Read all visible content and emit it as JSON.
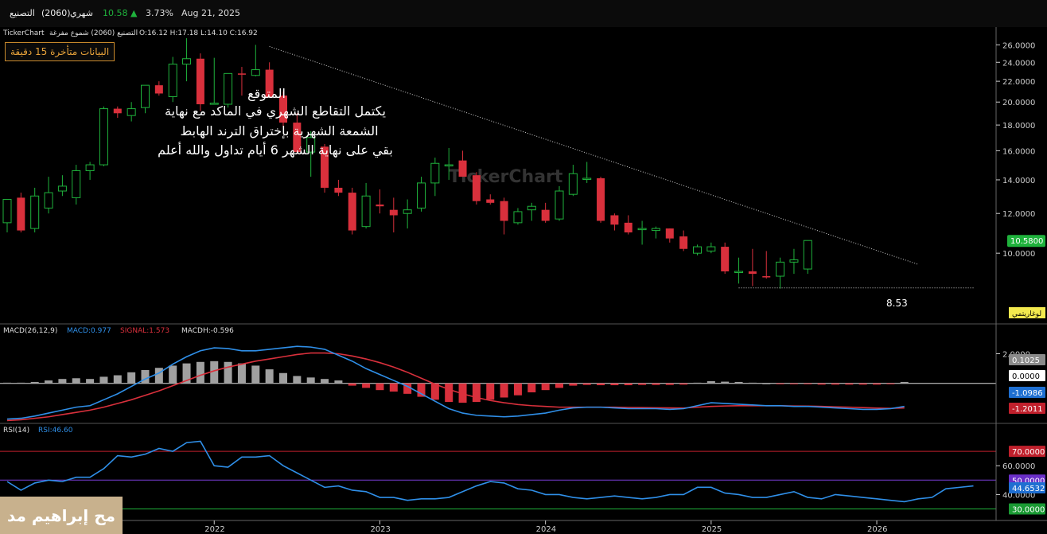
{
  "header": {
    "date": "Aug 21, 2025",
    "change_pct": "3.73%",
    "price": "10.58",
    "period": "شهري",
    "symbol": "(2060)",
    "name": "التصنيع"
  },
  "chart_header": {
    "brand": "TickerChart",
    "title": "التصنيع (2060) شموع مفرغة",
    "ohlc": "O:16.12  H:17.18  L:14.10  C:16.92"
  },
  "delay_notice": "البيانات متأخرة 15 دقيقة",
  "annotation": {
    "line1": "المتوقع",
    "line2": "يكتمل التقاطع الشهري في الماكد مع نهاية",
    "line3": "الشمعة الشهرية بإختراق الترند الهابط",
    "line4": "بقي على نهاية الشهر  6 أيام تداول والله أعلم"
  },
  "low_label": "8.53",
  "log_label": "لوغاريتمي",
  "watermark": "TickerChart",
  "author": "مح إبراهيم مد",
  "colors": {
    "up": "#1fb23c",
    "down": "#d9303c",
    "macd": "#2f8fe8",
    "signal": "#d9303c",
    "rsi": "#2f8fe8",
    "hist_pos": "#a0a0a0",
    "hist_neg": "#d9303c",
    "axis": "#cccccc"
  },
  "chart_data": [
    {
      "type": "candlestick",
      "title": "التصنيع (2060)",
      "scale": "log",
      "ylim": [
        7.5,
        27
      ],
      "yticks": [
        "26.0000",
        "24.0000",
        "22.0000",
        "20.0000",
        "18.0000",
        "16.0000",
        "14.0000",
        "12.0000",
        "10.0000"
      ],
      "xlabels": [
        {
          "label": "2022",
          "at": 15
        },
        {
          "label": "2023",
          "at": 27
        },
        {
          "label": "2024",
          "at": 39
        },
        {
          "label": "2025",
          "at": 51
        },
        {
          "label": "2026",
          "at": 63
        }
      ],
      "last_price": "10.5800",
      "candles": [
        {
          "o": 11.5,
          "h": 12.2,
          "l": 11.0,
          "c": 12.8
        },
        {
          "o": 12.9,
          "h": 13.2,
          "l": 11.0,
          "c": 11.1
        },
        {
          "o": 11.2,
          "h": 13.5,
          "l": 11.0,
          "c": 13.0
        },
        {
          "o": 12.3,
          "h": 14.2,
          "l": 12.0,
          "c": 13.2
        },
        {
          "o": 13.3,
          "h": 14.3,
          "l": 13.0,
          "c": 13.6
        },
        {
          "o": 12.9,
          "h": 15.0,
          "l": 12.5,
          "c": 14.6
        },
        {
          "o": 14.6,
          "h": 15.2,
          "l": 14.0,
          "c": 15.0
        },
        {
          "o": 15.0,
          "h": 19.6,
          "l": 14.9,
          "c": 19.4
        },
        {
          "o": 19.4,
          "h": 19.6,
          "l": 18.6,
          "c": 19.0
        },
        {
          "o": 18.8,
          "h": 20.0,
          "l": 18.3,
          "c": 19.4
        },
        {
          "o": 19.5,
          "h": 21.6,
          "l": 19.0,
          "c": 21.6
        },
        {
          "o": 21.6,
          "h": 22.0,
          "l": 20.6,
          "c": 20.8
        },
        {
          "o": 20.5,
          "h": 24.6,
          "l": 20.0,
          "c": 23.8
        },
        {
          "o": 23.8,
          "h": 26.8,
          "l": 22.0,
          "c": 24.4
        },
        {
          "o": 24.4,
          "h": 25.0,
          "l": 19.2,
          "c": 19.8
        },
        {
          "o": 19.8,
          "h": 24.5,
          "l": 19.8,
          "c": 19.9
        },
        {
          "o": 19.8,
          "h": 22.5,
          "l": 19.5,
          "c": 22.8
        },
        {
          "o": 22.8,
          "h": 23.5,
          "l": 20.6,
          "c": 22.7
        },
        {
          "o": 22.6,
          "h": 26.0,
          "l": 22.5,
          "c": 23.2
        },
        {
          "o": 23.2,
          "h": 24.0,
          "l": 20.5,
          "c": 20.5
        },
        {
          "o": 20.6,
          "h": 21.0,
          "l": 17.8,
          "c": 18.2
        },
        {
          "o": 18.2,
          "h": 19.0,
          "l": 15.8,
          "c": 15.9
        },
        {
          "o": 15.9,
          "h": 17.5,
          "l": 14.2,
          "c": 17.0
        },
        {
          "o": 16.3,
          "h": 16.5,
          "l": 13.2,
          "c": 13.5
        },
        {
          "o": 13.5,
          "h": 14.0,
          "l": 13.0,
          "c": 13.2
        },
        {
          "o": 13.2,
          "h": 13.5,
          "l": 10.9,
          "c": 11.1
        },
        {
          "o": 11.3,
          "h": 13.8,
          "l": 11.2,
          "c": 13.0
        },
        {
          "o": 12.5,
          "h": 13.4,
          "l": 12.0,
          "c": 12.4
        },
        {
          "o": 12.2,
          "h": 12.9,
          "l": 11.0,
          "c": 11.9
        },
        {
          "o": 12.0,
          "h": 12.8,
          "l": 11.2,
          "c": 12.2
        },
        {
          "o": 12.3,
          "h": 14.2,
          "l": 12.1,
          "c": 13.8
        },
        {
          "o": 13.8,
          "h": 15.5,
          "l": 13.0,
          "c": 15.1
        },
        {
          "o": 15.0,
          "h": 16.2,
          "l": 14.0,
          "c": 15.0
        },
        {
          "o": 15.3,
          "h": 16.0,
          "l": 14.2,
          "c": 14.2
        },
        {
          "o": 14.3,
          "h": 14.5,
          "l": 12.5,
          "c": 12.7
        },
        {
          "o": 12.8,
          "h": 13.1,
          "l": 12.5,
          "c": 12.6
        },
        {
          "o": 12.7,
          "h": 12.9,
          "l": 10.9,
          "c": 11.6
        },
        {
          "o": 11.5,
          "h": 12.3,
          "l": 11.4,
          "c": 12.1
        },
        {
          "o": 12.2,
          "h": 12.6,
          "l": 11.6,
          "c": 12.4
        },
        {
          "o": 12.2,
          "h": 12.6,
          "l": 11.5,
          "c": 11.6
        },
        {
          "o": 11.7,
          "h": 13.6,
          "l": 11.6,
          "c": 13.3
        },
        {
          "o": 13.1,
          "h": 15.0,
          "l": 13.0,
          "c": 14.4
        },
        {
          "o": 14.1,
          "h": 15.2,
          "l": 13.8,
          "c": 14.1
        },
        {
          "o": 14.1,
          "h": 14.2,
          "l": 11.5,
          "c": 11.6
        },
        {
          "o": 11.9,
          "h": 12.0,
          "l": 11.1,
          "c": 11.4
        },
        {
          "o": 11.5,
          "h": 11.9,
          "l": 10.9,
          "c": 11.0
        },
        {
          "o": 11.2,
          "h": 11.6,
          "l": 10.4,
          "c": 11.2
        },
        {
          "o": 11.1,
          "h": 11.3,
          "l": 10.7,
          "c": 11.2
        },
        {
          "o": 11.2,
          "h": 11.2,
          "l": 10.5,
          "c": 10.7
        },
        {
          "o": 10.8,
          "h": 11.1,
          "l": 10.1,
          "c": 10.2
        },
        {
          "o": 10.0,
          "h": 10.4,
          "l": 9.9,
          "c": 10.3
        },
        {
          "o": 10.1,
          "h": 10.5,
          "l": 10.0,
          "c": 10.3
        },
        {
          "o": 10.3,
          "h": 10.5,
          "l": 9.1,
          "c": 9.2
        },
        {
          "o": 9.2,
          "h": 9.8,
          "l": 8.7,
          "c": 9.2
        },
        {
          "o": 9.2,
          "h": 10.2,
          "l": 8.6,
          "c": 9.1
        },
        {
          "o": 9.0,
          "h": 10.1,
          "l": 8.9,
          "c": 8.95
        },
        {
          "o": 9.0,
          "h": 9.8,
          "l": 8.5,
          "c": 9.6
        },
        {
          "o": 9.6,
          "h": 10.2,
          "l": 9.1,
          "c": 9.7
        },
        {
          "o": 9.3,
          "h": 10.6,
          "l": 9.1,
          "c": 10.6
        }
      ],
      "trendline": [
        {
          "i": 19,
          "v": 25.8
        },
        {
          "i": 66,
          "v": 9.5
        }
      ],
      "low_line": {
        "from_i": 53,
        "to_i": 70,
        "v": 8.53
      }
    },
    {
      "type": "line",
      "title": "MACD(26,12,9)",
      "legend": {
        "macd": "MACD:0.977",
        "signal": "SIGNAL:1.573",
        "hist": "MACDH:-0.596"
      },
      "ylim": [
        -2.8,
        3.1
      ],
      "ytick": "2.0000",
      "badges": {
        "hist": "0.1025",
        "zero": "0.0000",
        "macd": "-1.0986",
        "signal": "-1.2011"
      },
      "macd": [
        -2.4,
        -2.35,
        -2.2,
        -2.0,
        -1.8,
        -1.6,
        -1.5,
        -1.1,
        -0.7,
        -0.2,
        0.3,
        0.7,
        1.3,
        1.8,
        2.2,
        2.4,
        2.35,
        2.2,
        2.2,
        2.3,
        2.4,
        2.5,
        2.45,
        2.3,
        1.9,
        1.5,
        1.0,
        0.6,
        0.2,
        -0.2,
        -0.7,
        -1.2,
        -1.7,
        -2.0,
        -2.15,
        -2.2,
        -2.25,
        -2.2,
        -2.1,
        -2.0,
        -1.8,
        -1.65,
        -1.6,
        -1.6,
        -1.65,
        -1.7,
        -1.7,
        -1.7,
        -1.75,
        -1.7,
        -1.5,
        -1.3,
        -1.35,
        -1.4,
        -1.45,
        -1.5,
        -1.5,
        -1.55,
        -1.55,
        -1.6,
        -1.65,
        -1.7,
        -1.75,
        -1.75,
        -1.7,
        -1.55
      ],
      "signal": [
        -2.5,
        -2.45,
        -2.35,
        -2.25,
        -2.1,
        -1.95,
        -1.8,
        -1.6,
        -1.35,
        -1.1,
        -0.8,
        -0.5,
        -0.15,
        0.2,
        0.55,
        0.85,
        1.1,
        1.3,
        1.5,
        1.65,
        1.8,
        1.95,
        2.05,
        2.05,
        2.0,
        1.85,
        1.65,
        1.4,
        1.1,
        0.75,
        0.35,
        -0.05,
        -0.4,
        -0.7,
        -0.95,
        -1.15,
        -1.3,
        -1.42,
        -1.5,
        -1.55,
        -1.6,
        -1.6,
        -1.6,
        -1.6,
        -1.6,
        -1.62,
        -1.63,
        -1.64,
        -1.65,
        -1.66,
        -1.6,
        -1.55,
        -1.52,
        -1.5,
        -1.5,
        -1.5,
        -1.5,
        -1.52,
        -1.53,
        -1.55,
        -1.58,
        -1.6,
        -1.63,
        -1.66,
        -1.68,
        -1.65
      ],
      "hist": [
        0.05,
        0.05,
        0.1,
        0.2,
        0.3,
        0.35,
        0.3,
        0.45,
        0.55,
        0.75,
        0.9,
        1.05,
        1.2,
        1.35,
        1.45,
        1.5,
        1.45,
        1.35,
        1.2,
        0.95,
        0.7,
        0.5,
        0.4,
        0.3,
        0.2,
        -0.15,
        -0.3,
        -0.45,
        -0.55,
        -0.7,
        -0.9,
        -1.1,
        -1.25,
        -1.3,
        -1.25,
        -1.1,
        -0.95,
        -0.8,
        -0.6,
        -0.45,
        -0.3,
        -0.15,
        -0.1,
        -0.12,
        -0.12,
        -0.12,
        -0.1,
        -0.1,
        -0.1,
        -0.08,
        0.05,
        0.15,
        0.12,
        0.1,
        0.05,
        0,
        -0.05,
        -0.05,
        -0.05,
        -0.08,
        -0.08,
        -0.08,
        -0.08,
        -0.08,
        -0.05,
        0.1
      ]
    },
    {
      "type": "line",
      "title": "RSI(14)",
      "legend": "RSI:46.60",
      "ylim": [
        22,
        80
      ],
      "yticks": [
        "60.0000",
        "40.0000"
      ],
      "levels": {
        "upper": "70.0000",
        "mid": "50.0000",
        "lower": "30.0000"
      },
      "last_badge": "44.6532",
      "values": [
        49,
        43,
        48,
        50,
        49,
        52,
        52,
        58,
        67,
        66,
        68,
        72,
        70,
        76,
        77,
        60,
        59,
        66,
        66,
        67,
        60,
        55,
        50,
        45,
        46,
        43,
        42,
        38,
        38,
        36,
        37,
        37,
        38,
        42,
        46,
        49,
        48,
        44,
        43,
        40,
        40,
        38,
        37,
        38,
        39,
        38,
        37,
        38,
        40,
        40,
        45,
        45,
        41,
        40,
        38,
        38,
        40,
        42,
        38,
        37,
        40,
        39,
        38,
        37,
        36,
        35,
        37,
        38,
        44,
        45,
        46
      ]
    }
  ]
}
